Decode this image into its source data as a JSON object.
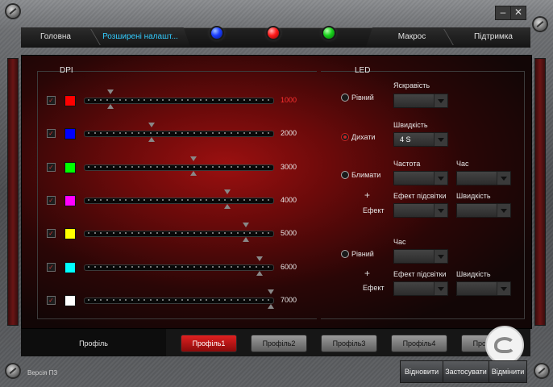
{
  "window": {
    "minimize_label": "–",
    "close_label": "✕"
  },
  "nav": {
    "tabs": [
      {
        "label": "Головна"
      },
      {
        "label": "Розширені налашт..."
      },
      {
        "label": "Макрос"
      },
      {
        "label": "Підтримка"
      }
    ],
    "active_tab": 1,
    "led_indicators": [
      "blue",
      "red",
      "green"
    ],
    "led_colors": {
      "blue": "#1a3cff",
      "red": "#ff1a1a",
      "green": "#17d01a"
    }
  },
  "dpi": {
    "title": "DPI",
    "active_index": 0,
    "rows": [
      {
        "color": "#ff0000",
        "value": "1000",
        "level": 0.14
      },
      {
        "color": "#0000ff",
        "value": "2000",
        "level": 0.36
      },
      {
        "color": "#00ff00",
        "value": "3000",
        "level": 0.58
      },
      {
        "color": "#ff00ff",
        "value": "4000",
        "level": 0.76
      },
      {
        "color": "#ffff00",
        "value": "5000",
        "level": 0.86
      },
      {
        "color": "#00ffff",
        "value": "6000",
        "level": 0.93
      },
      {
        "color": "#ffffff",
        "value": "7000",
        "level": 0.99
      }
    ]
  },
  "led": {
    "title": "LED",
    "steady": {
      "label": "Рівний",
      "brightness_label": "Яскравість"
    },
    "breathing": {
      "label": "Дихати",
      "speed_label": "Швидкість",
      "speed_value": "4 S"
    },
    "blink": {
      "label": "Блимати",
      "frequency_label": "Частота",
      "time_label": "Час",
      "plus": "+",
      "effect_label": "Ефект",
      "backlight_label": "Ефект підсвітки",
      "speed_label": "Швидкість"
    },
    "steady2": {
      "label": "Рівний",
      "time_label": "Час",
      "plus": "+",
      "effect_label": "Ефект",
      "backlight_label": "Ефект підсвітки",
      "speed_label": "Швидкість"
    },
    "selected": "breathing"
  },
  "profiles": {
    "label": "Профіль",
    "buttons": [
      "Профіль1",
      "Профіль2",
      "Профіль3",
      "Профіль4",
      "Профіль5"
    ],
    "active_index": 0
  },
  "footer": {
    "version": "Версія ПЗ",
    "restore": "Відновити",
    "apply": "Застосувати",
    "cancel": "Відмінити"
  }
}
